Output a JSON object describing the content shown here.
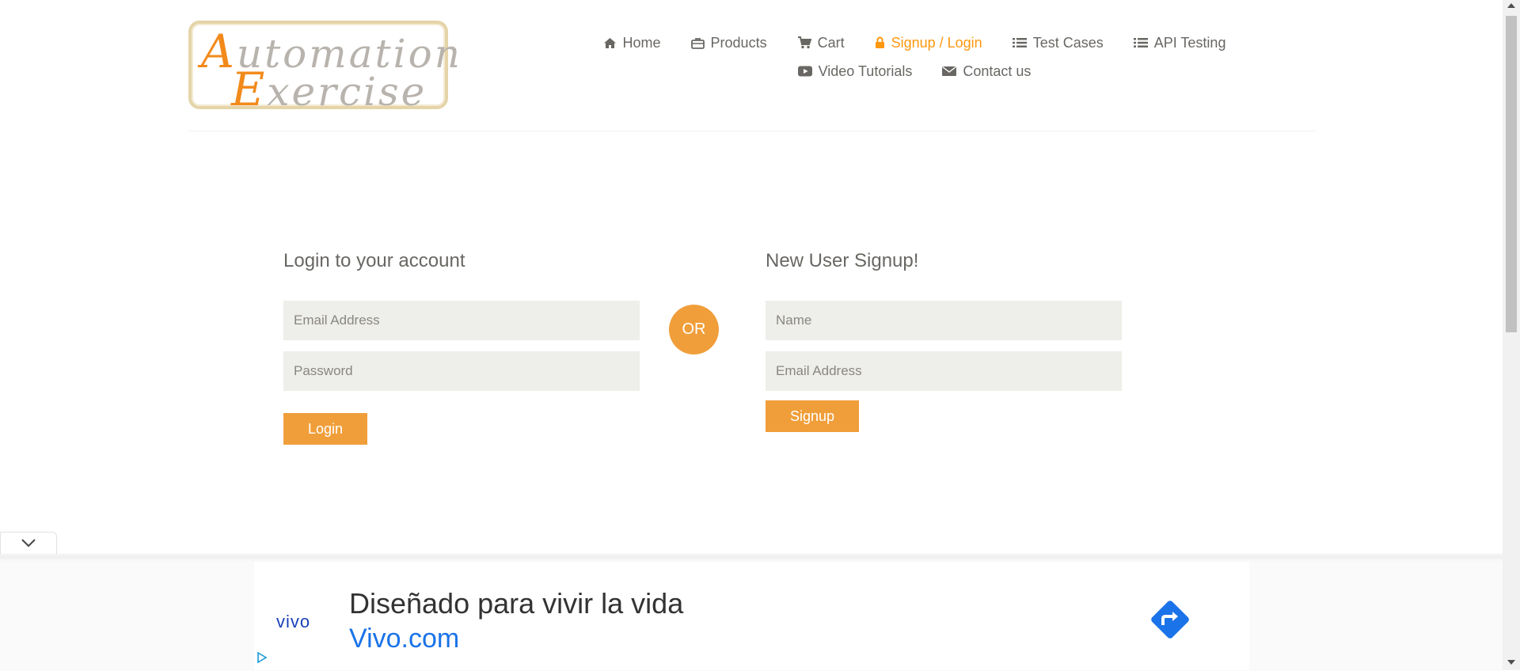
{
  "logo": {
    "line1": "utomation",
    "line1_cap": "A",
    "line2": "xercise",
    "line2_cap": "E"
  },
  "nav": {
    "row1": [
      {
        "label": "Home",
        "icon": "home-icon"
      },
      {
        "label": "Products",
        "icon": "briefcase-icon"
      },
      {
        "label": "Cart",
        "icon": "cart-icon"
      },
      {
        "label": "Signup / Login",
        "icon": "lock-icon",
        "active": true
      },
      {
        "label": "Test Cases",
        "icon": "list-icon"
      },
      {
        "label": "API Testing",
        "icon": "list-icon"
      }
    ],
    "row2": [
      {
        "label": "Video Tutorials",
        "icon": "youtube-icon"
      },
      {
        "label": "Contact us",
        "icon": "envelope-icon"
      }
    ]
  },
  "login": {
    "title": "Login to your account",
    "email_placeholder": "Email Address",
    "password_placeholder": "Password",
    "button": "Login"
  },
  "or_label": "OR",
  "signup": {
    "title": "New User Signup!",
    "name_placeholder": "Name",
    "email_placeholder": "Email Address",
    "button": "Signup"
  },
  "ad": {
    "brand": "vivo",
    "headline": "Diseñado para vivir la vida",
    "url": "Vivo.com"
  },
  "colors": {
    "accent": "#fe980f",
    "button": "#f09e3a",
    "field_bg": "#eeeeea",
    "text": "#696763"
  }
}
